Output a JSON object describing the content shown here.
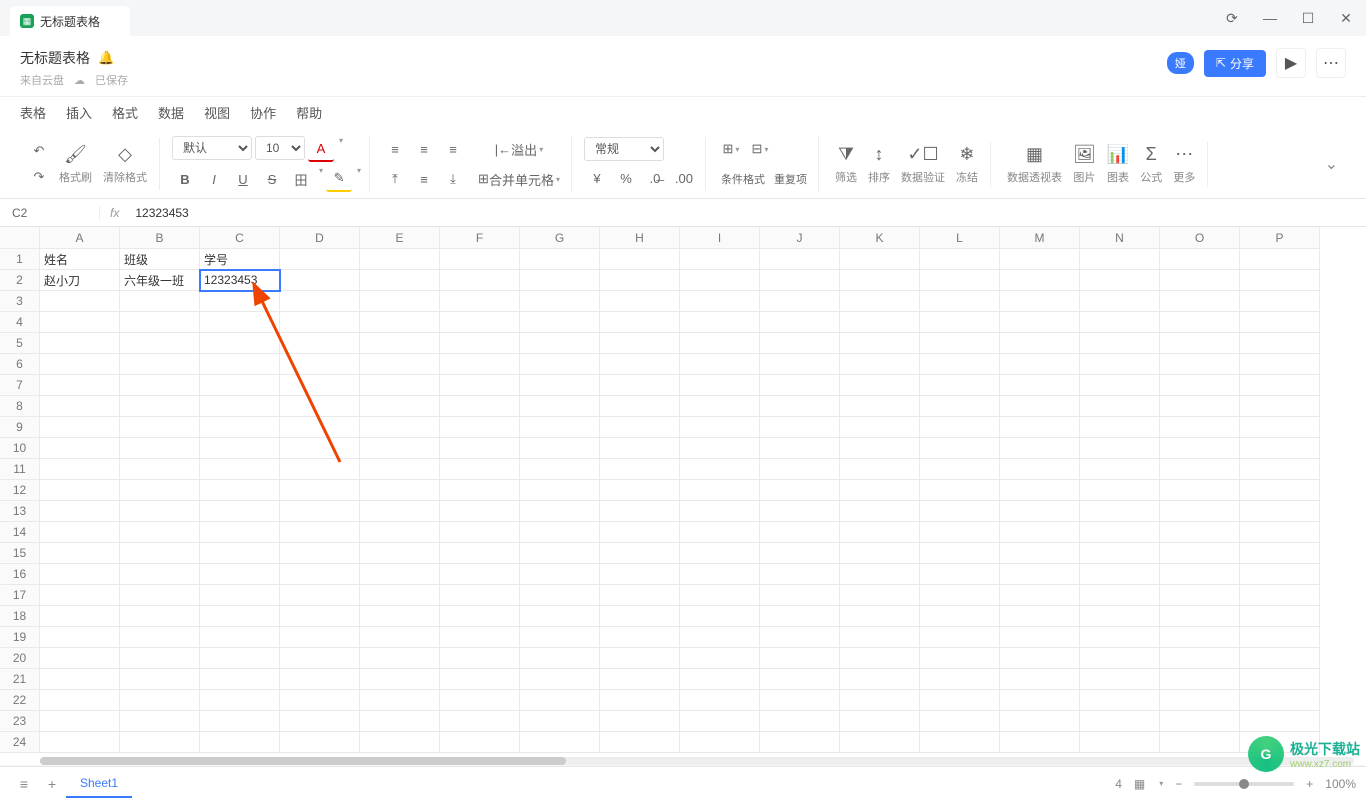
{
  "tab": {
    "title": "无标题表格"
  },
  "window": {
    "refresh": "⟳",
    "min": "—",
    "max": "☐",
    "close": "✕"
  },
  "doc": {
    "title": "无标题表格",
    "source": "来自云盘",
    "saved": "已保存"
  },
  "header_actions": {
    "badge": "娅",
    "share": "分享",
    "play": "▶",
    "more": "⋯"
  },
  "menu": [
    "表格",
    "插入",
    "格式",
    "数据",
    "视图",
    "协作",
    "帮助"
  ],
  "toolbar": {
    "undo": "↶",
    "redo": "↷",
    "format_painter": "格式刷",
    "clear_format": "清除格式",
    "font": "默认",
    "font_size": "10",
    "bold": "B",
    "italic": "I",
    "underline": "U",
    "strike": "S",
    "font_color": "A",
    "fill_color": "◪",
    "border": "田",
    "align_left": "≡",
    "align_center": "≡",
    "align_right": "≡",
    "valign_top": "⊤",
    "valign_mid": "≡",
    "valign_bot": "⊥",
    "wrap": "↵",
    "overflow_label": "溢出",
    "merge": "合并单元格",
    "merge_icon": "⬚",
    "num_format": "常规",
    "currency": "¥",
    "percent": "%",
    "dec_inc": ".0",
    "dec_dec": ".00",
    "insert_row": "⊞",
    "insert_col": "⊟",
    "cond_format": "条件格式",
    "dup": "重复项",
    "filter": "筛选",
    "sort": "排序",
    "validate": "数据验证",
    "freeze": "冻结",
    "pivot": "数据透视表",
    "image": "图片",
    "chart": "图表",
    "formula": "公式",
    "more": "更多"
  },
  "formula_bar": {
    "cell_ref": "C2",
    "fx": "fx",
    "value": "12323453"
  },
  "columns": [
    "A",
    "B",
    "C",
    "D",
    "E",
    "F",
    "G",
    "H",
    "I",
    "J",
    "K",
    "L",
    "M",
    "N",
    "O",
    "P"
  ],
  "row_count": 24,
  "cells": {
    "A1": "姓名",
    "B1": "班级",
    "C1": "学号",
    "A2": "赵小刀",
    "B2": "六年级一班",
    "C2": "12323453"
  },
  "selected": "C2",
  "sheet": {
    "name": "Sheet1",
    "list_icon": "≡",
    "add": "+"
  },
  "status": {
    "count_label": "4",
    "view_icon": "▦",
    "zoom": "100%",
    "zoom_minus": "−",
    "zoom_plus": "+"
  },
  "watermark": {
    "logo": "G",
    "text": "极光下载站",
    "sub": "www.xz7.com"
  }
}
